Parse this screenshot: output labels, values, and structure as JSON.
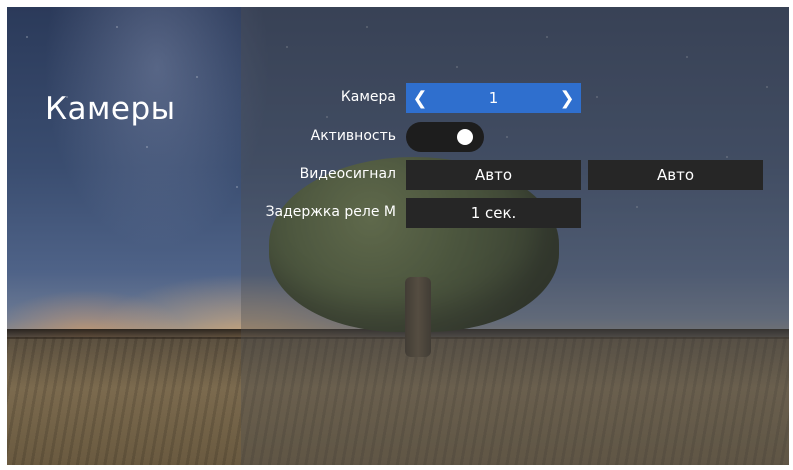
{
  "page": {
    "title": "Камеры"
  },
  "settings": {
    "camera": {
      "label": "Камера",
      "value": "1"
    },
    "activity": {
      "label": "Активность",
      "enabled": true
    },
    "video_signal": {
      "label": "Видеосигнал",
      "value1": "Авто",
      "value2": "Авто"
    },
    "relay_delay": {
      "label": "Задержка реле М",
      "value": "1 сек."
    }
  },
  "colors": {
    "accent": "#2f6fce",
    "field_bg": "#262626",
    "toggle_bg": "#1d1d1d",
    "text": "#ffffff"
  },
  "icons": {
    "prev": "chevron-left-icon",
    "next": "chevron-right-icon"
  }
}
